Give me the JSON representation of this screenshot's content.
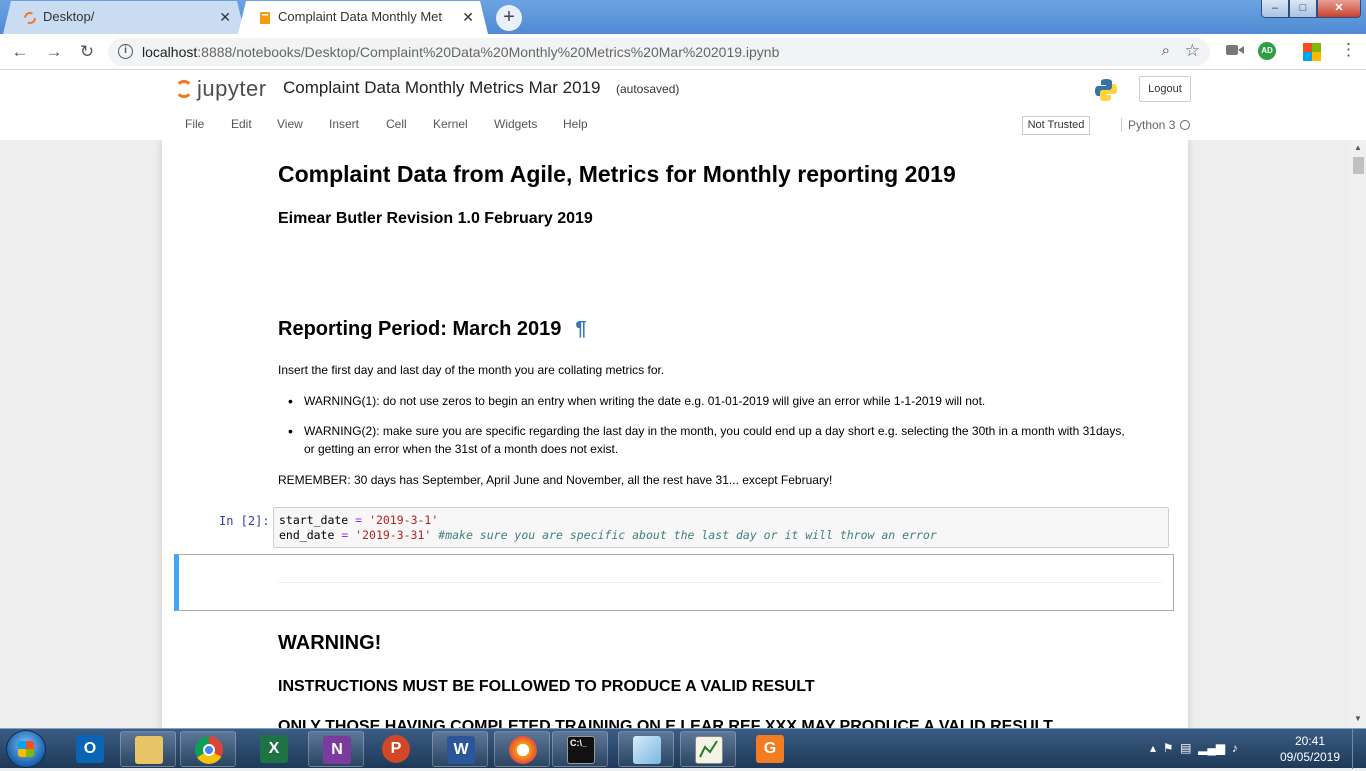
{
  "browser": {
    "tabs": [
      {
        "label": "Desktop/",
        "active": false
      },
      {
        "label": "Complaint Data Monthly Metrics",
        "active": true
      }
    ],
    "new_tab": "+",
    "url_host": "localhost",
    "url_rest": ":8888/notebooks/Desktop/Complaint%20Data%20Monthly%20Metrics%20Mar%202019.ipynb",
    "profile_initials": "AD",
    "window_controls": {
      "minimize": "–",
      "maximize": "□",
      "close": "✕"
    }
  },
  "jupyter": {
    "logo_text": "jupyter",
    "notebook_title": "Complaint Data Monthly Metrics Mar 2019",
    "autosave_status": "(autosaved)",
    "logout_label": "Logout",
    "menu": [
      "File",
      "Edit",
      "View",
      "Insert",
      "Cell",
      "Kernel",
      "Widgets",
      "Help"
    ],
    "trust_status": "Not Trusted",
    "kernel": "Python 3"
  },
  "notebook": {
    "title": "Complaint Data from Agile, Metrics for Monthly reporting 2019",
    "subtitle": "Eimear Butler Revision 1.0 February 2019",
    "reporting_heading": "Reporting Period: March 2019",
    "pilcrow": "¶",
    "intro": "Insert the first day and last day of the month you are collating metrics for.",
    "warnings": [
      "WARNING(1): do not use zeros to begin an entry when writing the date e.g. 01-01-2019 will give an error while 1-1-2019 will not.",
      "WARNING(2): make sure you are specific regarding the last day in the month, you could end up a day short e.g. selecting the 30th in a month with 31days, or getting an error when the 31st of a month does not exist."
    ],
    "remember": "REMEMBER: 30 days has September, April June and November, all the rest have 31... except February!",
    "code_cell": {
      "prompt": "In [2]:",
      "line1_var": "start_date",
      "line1_op": " = ",
      "line1_str": "'2019-3-1'",
      "line2_var": "end_date",
      "line2_op": " = ",
      "line2_str": "'2019-3-31'",
      "line2_comment": " #make sure you are specific about the last day or it will throw an error"
    },
    "warning_heading": "WARNING!",
    "instructions": "INSTRUCTIONS MUST BE FOLLOWED TO PRODUCE A VALID RESULT",
    "partial_line": "ONLY THOSE HAVING COMPLETED TRAINING ON E LEAR REF XXX MAY PRODUCE A VALID RESULT"
  },
  "taskbar": {
    "apps": [
      "outlook-icon",
      "file-explorer-icon",
      "chrome-icon",
      "excel-icon",
      "onenote-icon",
      "powerpoint-icon",
      "word-icon",
      "browser-icon",
      "cmd-icon",
      "notepad-icon",
      "chart-app-icon",
      "pdf-icon"
    ],
    "time": "20:41",
    "date": "09/05/2019"
  },
  "colors": {
    "jupyter_orange": "#f37726",
    "selected_cell_border": "#42a5f5",
    "code_string": "#ba2121",
    "code_comment": "#408080",
    "prompt_blue": "#303f9f"
  }
}
